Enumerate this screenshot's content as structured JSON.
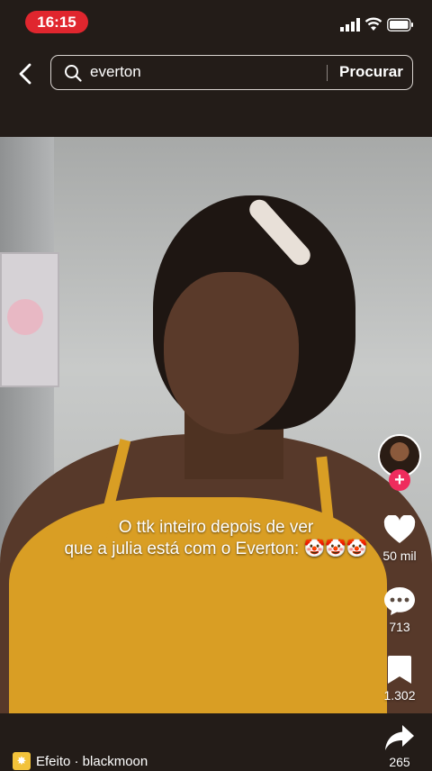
{
  "status_bar": {
    "time": "16:15"
  },
  "search": {
    "query": "everton",
    "button_label": "Procurar"
  },
  "video": {
    "caption_lines": [
      "O ttk inteiro depois de ver",
      "que a julia está com o Everton: 🤡🤡🤡"
    ]
  },
  "actions": {
    "likes": "50 mil",
    "comments": "713",
    "saves": "1.302",
    "shares": "265"
  },
  "effect": {
    "label": "Efeito · blackmoon"
  },
  "icons": [
    "back-icon",
    "search-icon",
    "heart-icon",
    "comment-icon",
    "bookmark-icon",
    "share-icon",
    "effect-icon"
  ]
}
